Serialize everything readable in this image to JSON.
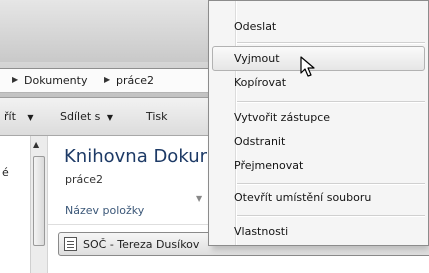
{
  "breadcrumb": {
    "items": [
      "Dokumenty",
      "práce2"
    ]
  },
  "toolbar": {
    "organize_partial": "řít",
    "share_label": "Sdílet s",
    "print_label": "Tisk"
  },
  "navpane": {
    "partial_label": "é"
  },
  "library": {
    "title": "Knihovna Dokur",
    "subtitle": "práce2",
    "column_header": "Název položky"
  },
  "file": {
    "name": "SOČ - Tereza Dusíkov"
  },
  "context_menu": {
    "items": [
      {
        "label": "Odeslat"
      },
      {
        "label": "Vyjmout"
      },
      {
        "label": "Kopírovat"
      },
      {
        "label": "Vytvořit zástupce"
      },
      {
        "label": "Odstranit"
      },
      {
        "label": "Přejmenovat"
      },
      {
        "label": "Otevřít umístění souboru"
      },
      {
        "label": "Vlastnosti"
      }
    ],
    "hovered": "Vyjmout"
  },
  "colors": {
    "menu_background": "#f5f5f5",
    "hover_border": "#b2b2b2",
    "library_title": "#1d3a66"
  }
}
